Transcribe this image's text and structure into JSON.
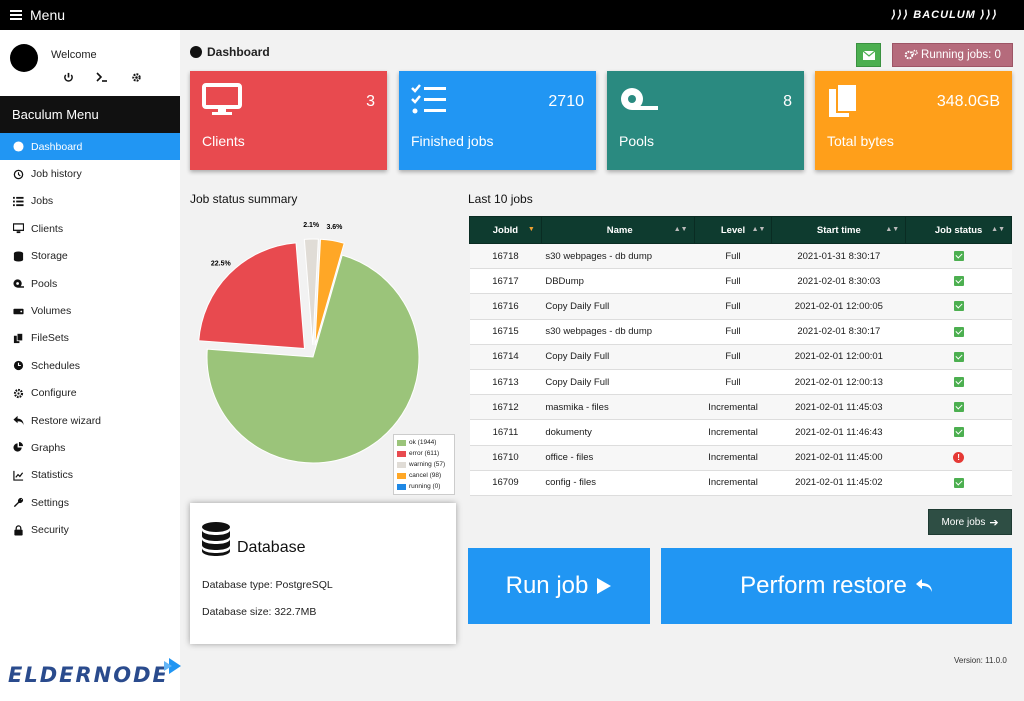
{
  "topbar": {
    "menu_label": "Menu",
    "brand": "⟩⟩⟩ BACULUM ⟩⟩⟩"
  },
  "sidebar": {
    "welcome": "Welcome",
    "title": "Baculum Menu",
    "items": [
      {
        "label": "Dashboard",
        "icon": "tachometer-icon"
      },
      {
        "label": "Job history",
        "icon": "history-icon"
      },
      {
        "label": "Jobs",
        "icon": "list-icon"
      },
      {
        "label": "Clients",
        "icon": "desktop-icon"
      },
      {
        "label": "Storage",
        "icon": "database-icon"
      },
      {
        "label": "Pools",
        "icon": "tape-icon"
      },
      {
        "label": "Volumes",
        "icon": "hdd-icon"
      },
      {
        "label": "FileSets",
        "icon": "copy-icon"
      },
      {
        "label": "Schedules",
        "icon": "clock-icon"
      },
      {
        "label": "Configure",
        "icon": "cog-icon"
      },
      {
        "label": "Restore wizard",
        "icon": "reply-icon"
      },
      {
        "label": "Graphs",
        "icon": "chart-pie-icon"
      },
      {
        "label": "Statistics",
        "icon": "chart-line-icon"
      },
      {
        "label": "Settings",
        "icon": "wrench-icon"
      },
      {
        "label": "Security",
        "icon": "lock-icon"
      }
    ],
    "logo_text": "ELDERNODE"
  },
  "main": {
    "dashboard_title": "Dashboard",
    "running_jobs": "Running jobs: 0",
    "cards": [
      {
        "label": "Clients",
        "value": "3",
        "color": "#e84a4f"
      },
      {
        "label": "Finished jobs",
        "value": "2710",
        "color": "#2196f3"
      },
      {
        "label": "Pools",
        "value": "8",
        "color": "#2a8a80"
      },
      {
        "label": "Total bytes",
        "value": "348.0GB",
        "color": "#ff9f1a"
      }
    ],
    "job_status_title": "Job status summary",
    "last_jobs_title": "Last 10 jobs",
    "more_jobs": "More jobs",
    "run_job": "Run job",
    "perform_restore": "Perform restore",
    "version": "Version: 11.0.0"
  },
  "table": {
    "headers": [
      "JobId",
      "Name",
      "Level",
      "Start time",
      "Job status"
    ],
    "rows": [
      {
        "id": "16718",
        "name": "s30 webpages - db dump",
        "level": "Full",
        "start": "2021-01-31 8:30:17",
        "status": "ok"
      },
      {
        "id": "16717",
        "name": "DBDump",
        "level": "Full",
        "start": "2021-02-01 8:30:03",
        "status": "ok"
      },
      {
        "id": "16716",
        "name": "Copy Daily Full",
        "level": "Full",
        "start": "2021-02-01 12:00:05",
        "status": "ok"
      },
      {
        "id": "16715",
        "name": "s30 webpages - db dump",
        "level": "Full",
        "start": "2021-02-01 8:30:17",
        "status": "ok"
      },
      {
        "id": "16714",
        "name": "Copy Daily Full",
        "level": "Full",
        "start": "2021-02-01 12:00:01",
        "status": "ok"
      },
      {
        "id": "16713",
        "name": "Copy Daily Full",
        "level": "Full",
        "start": "2021-02-01 12:00:13",
        "status": "ok"
      },
      {
        "id": "16712",
        "name": "masmika - files",
        "level": "Incremental",
        "start": "2021-02-01 11:45:03",
        "status": "ok"
      },
      {
        "id": "16711",
        "name": "dokumenty",
        "level": "Incremental",
        "start": "2021-02-01 11:46:43",
        "status": "ok"
      },
      {
        "id": "16710",
        "name": "office - files",
        "level": "Incremental",
        "start": "2021-02-01 11:45:00",
        "status": "error"
      },
      {
        "id": "16709",
        "name": "config - files",
        "level": "Incremental",
        "start": "2021-02-01 11:45:02",
        "status": "ok"
      }
    ]
  },
  "database": {
    "title": "Database",
    "type_line": "Database type: PostgreSQL",
    "size_line": "Database size: 322.7MB"
  },
  "chart_data": {
    "type": "pie",
    "categories": [
      "ok",
      "error",
      "warning",
      "cancel",
      "running"
    ],
    "values": [
      1944,
      611,
      57,
      98,
      0
    ],
    "legend_labels": [
      "ok (1944)",
      "error (611)",
      "warning (57)",
      "cancel (98)",
      "running (0)"
    ],
    "slice_labels": [
      "",
      "22.5%",
      "2.1%",
      "3.6%",
      ""
    ],
    "colors": [
      "#9bc47a",
      "#e84a4f",
      "#e0dcd6",
      "#ffa726",
      "#1e88e5"
    ],
    "legend_position": "bottom-right"
  }
}
